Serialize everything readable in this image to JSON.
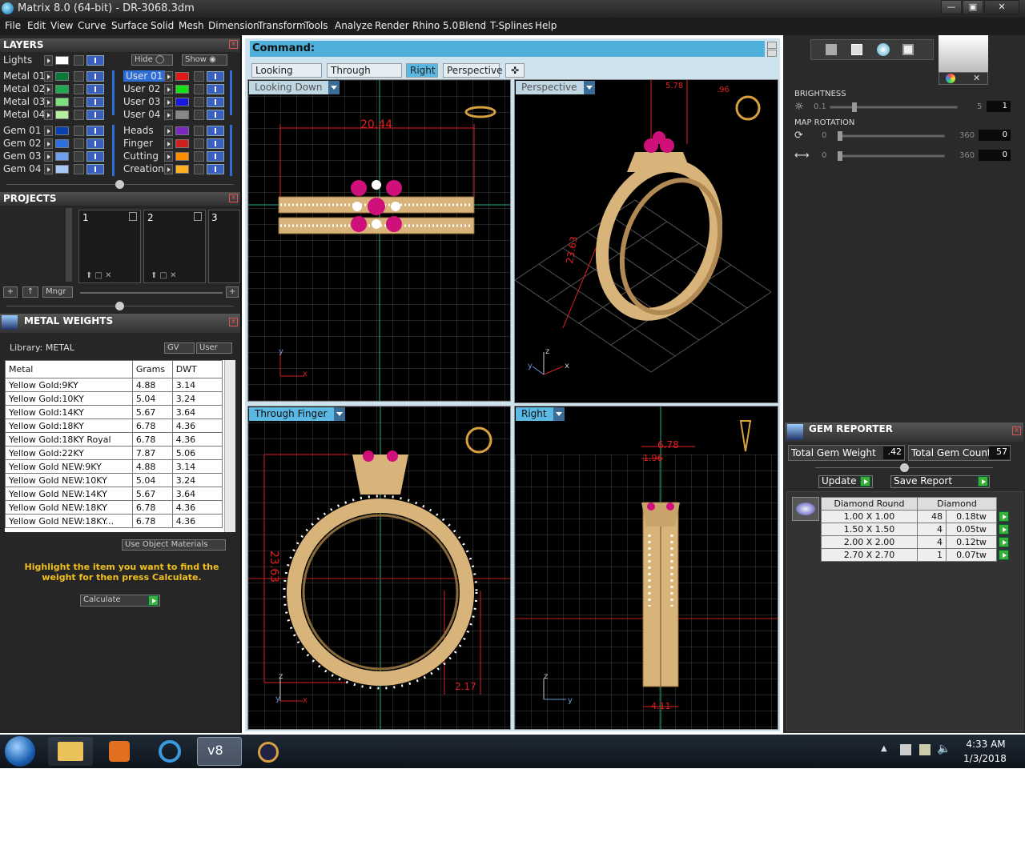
{
  "window": {
    "title": "Matrix 8.0 (64-bit) - DR-3068.3dm"
  },
  "menu": [
    "File",
    "Edit",
    "View",
    "Curve",
    "Surface",
    "Solid",
    "Mesh",
    "Dimension",
    "Transform",
    "Tools",
    "Analyze",
    "Render",
    "Rhino 5.0",
    "Blend",
    "T-Splines",
    "Help"
  ],
  "layers": {
    "title": "LAYERS",
    "lights_label": "Lights",
    "hide_label": "Hide",
    "show_label": "Show",
    "left": [
      {
        "name": "Metal 01",
        "color": "#0a7a3a"
      },
      {
        "name": "Metal 02",
        "color": "#1fa84f"
      },
      {
        "name": "Metal 03",
        "color": "#7fe07f"
      },
      {
        "name": "Metal 04",
        "color": "#b5f0a0"
      },
      {
        "name": "Gem 01",
        "color": "#0a3fb0"
      },
      {
        "name": "Gem 02",
        "color": "#2c6fe0"
      },
      {
        "name": "Gem 03",
        "color": "#6fa0f0"
      },
      {
        "name": "Gem 04",
        "color": "#a9c8f5"
      }
    ],
    "right": [
      {
        "name": "User 01",
        "color": "#e01818",
        "selected": true
      },
      {
        "name": "User 02",
        "color": "#18e018"
      },
      {
        "name": "User 03",
        "color": "#1818e0"
      },
      {
        "name": "User 04",
        "color": "#888888"
      },
      {
        "name": "Heads",
        "color": "#7a2ac0"
      },
      {
        "name": "Finger",
        "color": "#d02020"
      },
      {
        "name": "Cutting",
        "color": "#ff8c00"
      },
      {
        "name": "Creation",
        "color": "#ffb020"
      }
    ]
  },
  "projects": {
    "title": "PROJECTS",
    "slots": [
      "1",
      "2",
      "3"
    ],
    "mngr_label": "Mngr"
  },
  "metal_weights": {
    "title": "METAL WEIGHTS",
    "library": "Library: METAL",
    "gv": "GV",
    "user": "User",
    "columns": [
      "Metal",
      "Grams",
      "DWT"
    ],
    "rows": [
      [
        "Yellow Gold:9KY",
        "4.88",
        "3.14"
      ],
      [
        "Yellow Gold:10KY",
        "5.04",
        "3.24"
      ],
      [
        "Yellow Gold:14KY",
        "5.67",
        "3.64"
      ],
      [
        "Yellow Gold:18KY",
        "6.78",
        "4.36"
      ],
      [
        "Yellow Gold:18KY Royal",
        "6.78",
        "4.36"
      ],
      [
        "Yellow Gold:22KY",
        "7.87",
        "5.06"
      ],
      [
        "Yellow Gold NEW:9KY",
        "4.88",
        "3.14"
      ],
      [
        "Yellow Gold NEW:10KY",
        "5.04",
        "3.24"
      ],
      [
        "Yellow Gold NEW:14KY",
        "5.67",
        "3.64"
      ],
      [
        "Yellow Gold NEW:18KY",
        "6.78",
        "4.36"
      ],
      [
        "Yellow Gold NEW:18KY...",
        "6.78",
        "4.36"
      ]
    ],
    "use_object_materials": "Use Object Materials",
    "hint": "Highlight the item you want to find the weight for then press Calculate.",
    "calculate": "Calculate"
  },
  "command": {
    "label": "Command:"
  },
  "view_tabs": [
    "Looking Down",
    "Through Finger",
    "Right",
    "Perspective"
  ],
  "active_tab": "Right",
  "viewports": {
    "top_left": {
      "label": "Looking Down",
      "dim": "20.44"
    },
    "top_right": {
      "label": "Perspective",
      "dims": [
        "5.78",
        ".96",
        "23.63"
      ]
    },
    "bottom_left": {
      "label": "Through Finger",
      "dims": [
        "23.63",
        "2.17"
      ]
    },
    "bottom_right": {
      "label": "Right",
      "dims": [
        "6.78",
        "1.96",
        "4.11"
      ]
    }
  },
  "render": {
    "brightness_label": "BRIGHTNESS",
    "brightness": {
      "min": "0.1",
      "max": "5",
      "value": "1"
    },
    "map_rotation_label": "MAP ROTATION",
    "rot1": {
      "min": "0",
      "max": "360",
      "value": "0"
    },
    "rot2": {
      "min": "0",
      "max": "360",
      "value": "0"
    }
  },
  "gem_reporter": {
    "title": "GEM REPORTER",
    "total_weight_label": "Total Gem Weight",
    "total_weight": ".42",
    "total_count_label": "Total Gem Count",
    "total_count": "57",
    "update": "Update",
    "save_report": "Save Report",
    "headers": [
      "Diamond Round",
      "",
      "Diamond"
    ],
    "rows": [
      [
        "1.00 X 1.00",
        "48",
        "0.18tw"
      ],
      [
        "1.50 X 1.50",
        "4",
        "0.05tw"
      ],
      [
        "2.00 X 2.00",
        "4",
        "0.12tw"
      ],
      [
        "2.70 X 2.70",
        "1",
        "0.07tw"
      ]
    ]
  },
  "clock": {
    "time": "4:33 AM",
    "date": "1/3/2018"
  },
  "colors": {
    "accent": "#5ab8e3",
    "gold": "#d9b47a",
    "ruby": "#d0107a",
    "dim_red": "#e02020"
  }
}
